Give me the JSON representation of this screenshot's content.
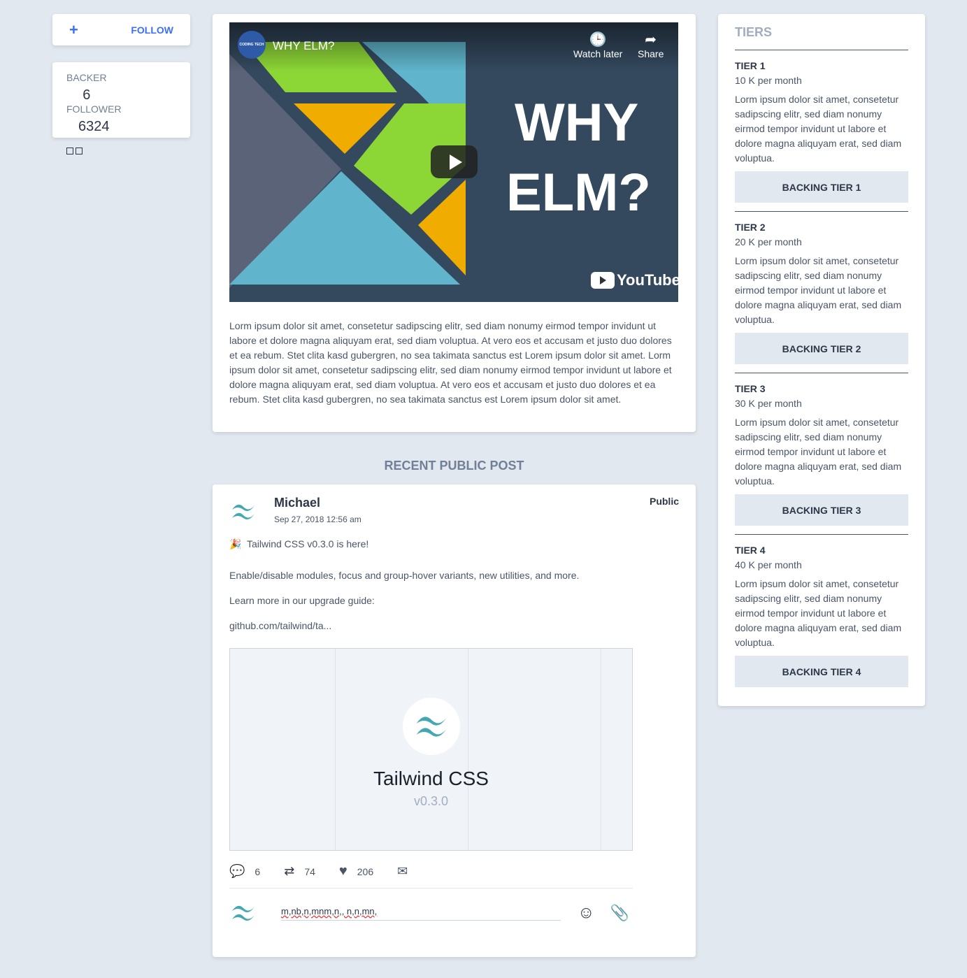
{
  "follow": {
    "label": "FOLLOW"
  },
  "stats": {
    "backer_label": "BACKER",
    "backer": "6",
    "follower_label": "FOLLOWER",
    "follower": "6324"
  },
  "video": {
    "title": "WHY ELM?",
    "watch_later": "Watch later",
    "share": "Share",
    "big1": "WHY",
    "big2": "ELM?",
    "brand": "YouTube",
    "channel": "CODING TECH"
  },
  "main": {
    "text": "Lorm ipsum dolor sit amet, consetetur sadipscing elitr, sed diam nonumy eirmod tempor invidunt ut labore et dolore magna aliquyam erat, sed diam voluptua. At vero eos et accusam et justo duo dolores et ea rebum. Stet clita kasd gubergren, no sea takimata sanctus est Lorem ipsum dolor sit amet. Lorm ipsum dolor sit amet, consetetur sadipscing elitr, sed diam nonumy eirmod tempor invidunt ut labore et dolore magna aliquyam erat, sed diam voluptua. At vero eos et accusam et justo duo dolores et ea rebum. Stet clita kasd gubergren, no sea takimata sanctus est Lorem ipsum dolor sit amet."
  },
  "recent_title": "RECENT PUBLIC POST",
  "post": {
    "author": "Michael",
    "date": "Sep 27, 2018 12:56 am",
    "visibility": "Public",
    "emoji": "🎉",
    "line1": "Tailwind CSS v0.3.0 is here!",
    "line2": "Enable/disable modules, focus and group-hover variants, new utilities, and more.",
    "line3": "Learn more in our upgrade guide:",
    "link": "github.com/tailwind/ta...",
    "preview_title": "Tailwind CSS",
    "preview_version": "v0.3.0",
    "comments": "6",
    "retweets": "74",
    "likes": "206",
    "reply": "m,nb,n,mnm,n,, n,n,mn,"
  },
  "tiers": {
    "title": "TIERS",
    "items": [
      {
        "name": "TIER 1",
        "price": "10 K per month",
        "desc": "Lorm ipsum dolor sit amet, consetetur sadipscing elitr, sed diam nonumy eirmod tempor invidunt ut labore et dolore magna aliquyam erat, sed diam voluptua.",
        "button": "BACKING TIER 1"
      },
      {
        "name": "TIER 2",
        "price": "20 K per month",
        "desc": "Lorm ipsum dolor sit amet, consetetur sadipscing elitr, sed diam nonumy eirmod tempor invidunt ut labore et dolore magna aliquyam erat, sed diam voluptua.",
        "button": "BACKING TIER 2"
      },
      {
        "name": "TIER 3",
        "price": "30 K per month",
        "desc": "Lorm ipsum dolor sit amet, consetetur sadipscing elitr, sed diam nonumy eirmod tempor invidunt ut labore et dolore magna aliquyam erat, sed diam voluptua.",
        "button": "BACKING TIER 3"
      },
      {
        "name": "TIER 4",
        "price": "40 K per month",
        "desc": "Lorm ipsum dolor sit amet, consetetur sadipscing elitr, sed diam nonumy eirmod tempor invidunt ut labore et dolore magna aliquyam erat, sed diam voluptua.",
        "button": "BACKING TIER 4"
      }
    ]
  }
}
